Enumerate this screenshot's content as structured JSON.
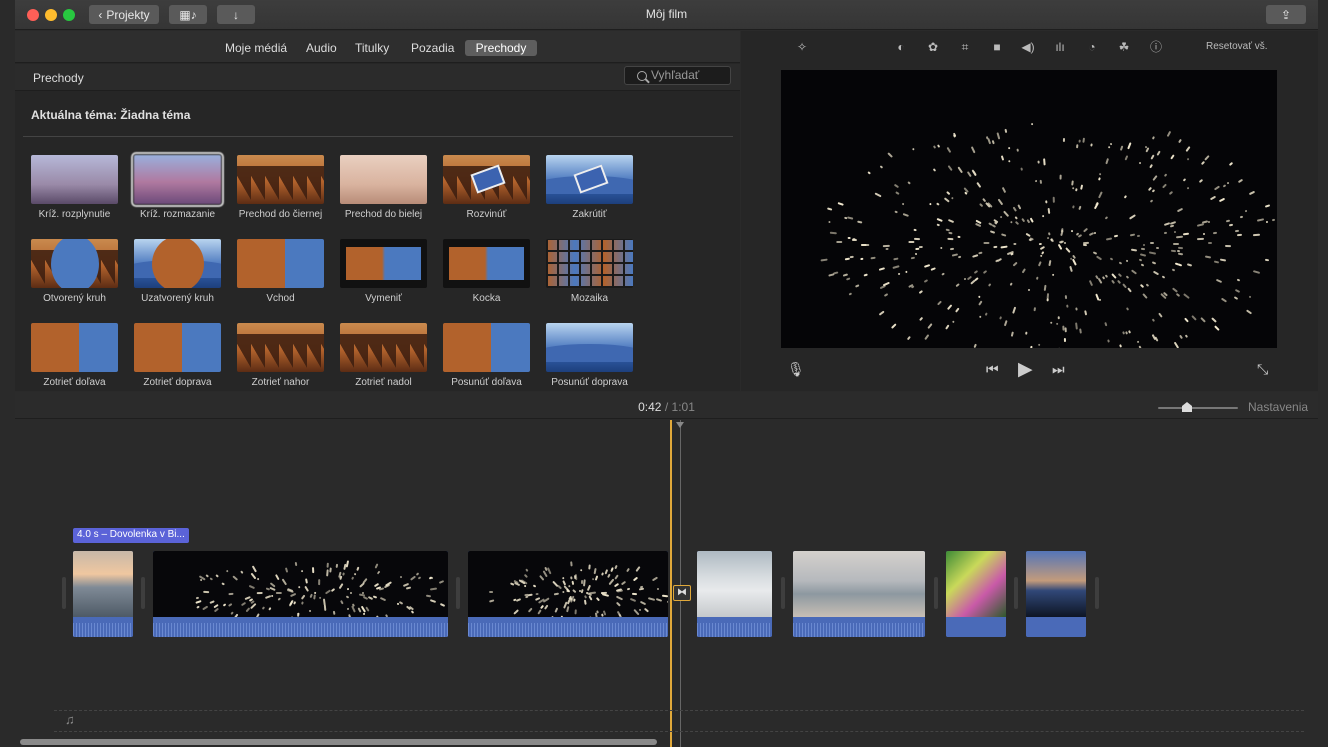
{
  "window": {
    "title": "Môj film"
  },
  "toolbar": {
    "projects_label": "Projekty"
  },
  "browser": {
    "tabs": [
      {
        "label": "Moje médiá"
      },
      {
        "label": "Audio"
      },
      {
        "label": "Titulky"
      },
      {
        "label": "Pozadia"
      },
      {
        "label": "Prechody"
      }
    ],
    "active_tab": "Prechody",
    "section_title": "Prechody",
    "search_placeholder": "Vyhľadať",
    "theme_label": "Aktuálna téma: Žiadna téma",
    "transitions": [
      {
        "label": "Kríž. rozplynutie",
        "thumb": "misty"
      },
      {
        "label": "Kríž. rozmazanie",
        "thumb": "blurred",
        "selected": true
      },
      {
        "label": "Prechod do čiernej",
        "thumb": "forest"
      },
      {
        "label": "Prechod do bielej",
        "thumb": "pale"
      },
      {
        "label": "Rozvinúť",
        "thumb": "forest card"
      },
      {
        "label": "Zakrútiť",
        "thumb": "lake card"
      },
      {
        "label": "Otvorený kruh",
        "thumb": "forest circle-in"
      },
      {
        "label": "Uzatvorený kruh",
        "thumb": "lake circle-out"
      },
      {
        "label": "Vchod",
        "thumb": "split-l"
      },
      {
        "label": "Vymeniť",
        "thumb": "dark-frame"
      },
      {
        "label": "Kocka",
        "thumb": "dark-frame"
      },
      {
        "label": "Mozaika",
        "thumb": "mosaic"
      },
      {
        "label": "Zotrieť doľava",
        "thumb": "split-l"
      },
      {
        "label": "Zotrieť doprava",
        "thumb": "split-l"
      },
      {
        "label": "Zotrieť nahor",
        "thumb": "forest"
      },
      {
        "label": "Zotrieť nadol",
        "thumb": "forest"
      },
      {
        "label": "Posunúť doľava",
        "thumb": "split-l"
      },
      {
        "label": "Posunúť doprava",
        "thumb": "lake"
      }
    ]
  },
  "viewer": {
    "reset_label": "Resetovať vš.",
    "tools": [
      "magic-wand-icon",
      "color-balance-icon",
      "color-palette-icon",
      "crop-icon",
      "stabilization-icon",
      "volume-icon",
      "equalizer-icon",
      "speed-icon",
      "filter-icon",
      "info-icon"
    ]
  },
  "timeline": {
    "current_time": "0:42",
    "separator": "/",
    "total_time": "1:01",
    "settings_label": "Nastavenia",
    "clip_label": "4.0 s – Dovolenka v Bi...",
    "clips": [
      {
        "name": "beach-clip",
        "style": "beach"
      },
      {
        "name": "fireworks-clip-1",
        "style": "fw"
      },
      {
        "name": "fireworks-clip-2",
        "style": "fw"
      },
      {
        "name": "waves-clip",
        "style": "waves"
      },
      {
        "name": "sea-clip",
        "style": "sea"
      },
      {
        "name": "party-clip",
        "style": "party"
      },
      {
        "name": "sunset-clip",
        "style": "sunset"
      }
    ]
  },
  "colors": {
    "accent": "#e1a93a",
    "clip_audio": "#4a6ab8",
    "label_bg": "#5b63d8"
  }
}
